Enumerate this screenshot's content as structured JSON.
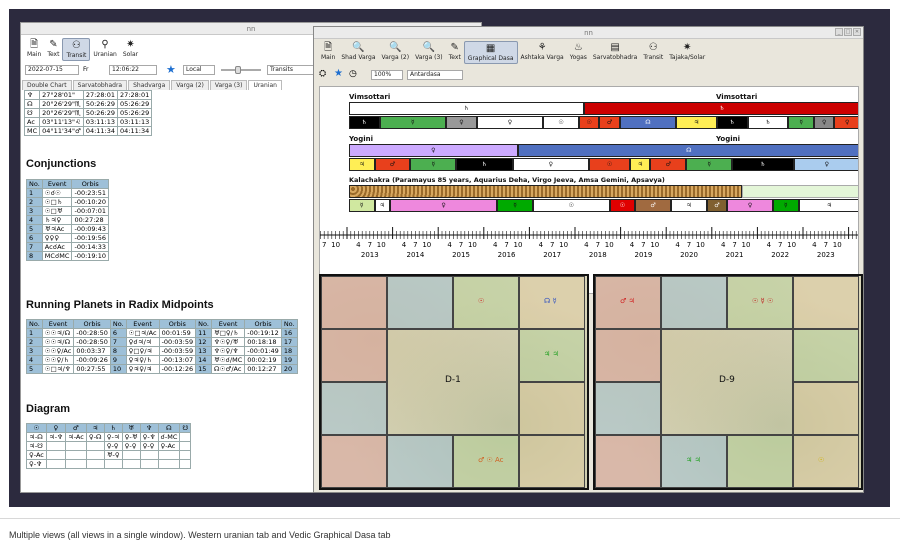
{
  "caption": "Multiple views (all views in a single window). Western uranian tab and Vedic Graphical Dasa tab",
  "left": {
    "title": "nn",
    "toolbar": [
      {
        "label": "Main",
        "icon": "doc-icon",
        "glyph": "🗎"
      },
      {
        "label": "Text",
        "icon": "edit-icon",
        "glyph": "✎"
      },
      {
        "label": "Transit",
        "icon": "transit-icon",
        "glyph": "⚇"
      },
      {
        "label": "Uranian",
        "icon": "uranian-icon",
        "glyph": "⚲"
      },
      {
        "label": "Solar",
        "icon": "solar-icon",
        "glyph": "✷"
      }
    ],
    "date": "2022-07-15",
    "day": "Fr",
    "time": "12:06:22",
    "tz": "Local",
    "mode": "Transits",
    "tabs": [
      "Double Chart",
      "Sarvatobhadra",
      "Shadvarga",
      "Varga (2)",
      "Varga (3)",
      "Uranian"
    ],
    "top_rows": [
      [
        "♆",
        "27°28'01\"",
        "27:28:01",
        "27:28:01"
      ],
      [
        "☊",
        "20°26'29\"♏",
        "50:26:29",
        "05:26:29"
      ],
      [
        "☋",
        "20°26'29\"♏",
        "50:26:29",
        "05:26:29"
      ],
      [
        "Ac",
        "03°11'13\"♌",
        "03:11:13",
        "03:11:13"
      ],
      [
        "MC",
        "04°11'34\"♂",
        "04:11:34",
        "04:11:34"
      ]
    ],
    "conj_title": "Conjunctions",
    "conj_headers": [
      "No.",
      "Event",
      "Orbis"
    ],
    "conj_rows": [
      [
        "1",
        "☉☌☉",
        "-00:23:51"
      ],
      [
        "2",
        "☉□♄",
        "-00:10:20"
      ],
      [
        "3",
        "☉□♅",
        "-00:07:01"
      ],
      [
        "4",
        "♄♃♀",
        "00:27:28"
      ],
      [
        "5",
        "♅♃Ac",
        "-00:09:43"
      ],
      [
        "6",
        "♀♀♀",
        "-00:19:56"
      ],
      [
        "7",
        "Ac☌Ac",
        "-00:14:33"
      ],
      [
        "8",
        "MC☌MC",
        "-00:19:10"
      ]
    ],
    "mid_title": "Running Planets in Radix Midpoints",
    "mid_headers": [
      "No.",
      "Event",
      "Orbis",
      "No.",
      "Event",
      "Orbis",
      "No.",
      "Event",
      "Orbis",
      "No."
    ],
    "mid_rows": [
      [
        "1",
        "☉☉♃/☊",
        "-00:28:50",
        "6",
        "☉□♃/Ac",
        "00:01:59",
        "11",
        "♅□♀/♄",
        "-00:19:12",
        "16"
      ],
      [
        "2",
        "☉☉♃/☊",
        "-00:28:50",
        "7",
        "♀☌♃/♃",
        "-00:03:59",
        "12",
        "♆☉♀/♅",
        "00:18:18",
        "17"
      ],
      [
        "3",
        "☉☉♀/Ac",
        "00:03:37",
        "8",
        "♀□♀/♃",
        "-00:03:59",
        "13",
        "♆☉♀/♆",
        "-00:01:49",
        "18"
      ],
      [
        "4",
        "☉☉♀/♄",
        "-00:09:26",
        "9",
        "♀♃♀/♄",
        "-00:13:07",
        "14",
        "♅☉☌/MC",
        "00:02:19",
        "19"
      ],
      [
        "5",
        "☉□♃/♆",
        "00:27:55",
        "10",
        "♀♃♀/♃",
        "-00:12:26",
        "15",
        "☊☉♂/Ac",
        "00:12:27",
        "20"
      ]
    ],
    "diag_title": "Diagram",
    "diag_headers": [
      "☉",
      "♀",
      "♂",
      "♃",
      "♄",
      "♅",
      "♆",
      "☊",
      "☋"
    ],
    "diag_rows": [
      [
        "♃-☊",
        "♃-♆",
        "♃-Ac",
        "♀-☊",
        "♀-♃",
        "♀-♅",
        "♀-♆",
        "☌-MC",
        ""
      ],
      [
        "♃-☋",
        "",
        "",
        "",
        "♀-♀",
        "♀-♀",
        "♀-♀",
        "♀-Ac",
        ""
      ],
      [
        "♀-Ac",
        "",
        "",
        "",
        "♅-♀",
        "",
        "",
        "",
        ""
      ],
      [
        "♀-♆",
        "",
        "",
        "",
        "",
        "",
        "",
        "",
        ""
      ]
    ]
  },
  "right": {
    "title": "nn",
    "toolbar": [
      {
        "label": "Main",
        "icon": "doc-icon",
        "glyph": "🗎"
      },
      {
        "label": "Shad Varga",
        "icon": "search-icon",
        "glyph": "🔍"
      },
      {
        "label": "Varga (2)",
        "icon": "search-icon",
        "glyph": "🔍"
      },
      {
        "label": "Varga (3)",
        "icon": "search-icon",
        "glyph": "🔍"
      },
      {
        "label": "Text",
        "icon": "edit-icon",
        "glyph": "✎"
      },
      {
        "label": "Graphical Dasa",
        "icon": "dasa-icon",
        "glyph": "▦"
      },
      {
        "label": "Ashtaka Varga",
        "icon": "ashtaka-icon",
        "glyph": "⚘"
      },
      {
        "label": "Yogas",
        "icon": "yogas-icon",
        "glyph": "♨"
      },
      {
        "label": "Sarvatobhadra",
        "icon": "grid-icon",
        "glyph": "▤"
      },
      {
        "label": "Transit",
        "icon": "transit-icon",
        "glyph": "⚇"
      },
      {
        "label": "Tajaka/Solar",
        "icon": "solar-icon",
        "glyph": "✷"
      }
    ],
    "zoom": "100%",
    "dasa_level": "Antardasa",
    "vims_label": "Vimsottari",
    "vims_label2": "Vimsottari",
    "yogini_label": "Yogini",
    "yogini_label2": "Yogini",
    "kala_label": "Kalachakra (Paramayus 85 years, Aquarius Deha, Virgo Jeeva, Amsa Gemini, Apsavya)",
    "vims_main": [
      {
        "label": "♄",
        "from": 0,
        "to": 0.46,
        "color": "#ffffff"
      },
      {
        "label": "♄",
        "from": 0.46,
        "to": 1.0,
        "color": "#cc0000"
      }
    ],
    "vims_sub": [
      {
        "label": "♄",
        "from": 0,
        "to": 0.06,
        "color": "#000000"
      },
      {
        "label": "☿",
        "from": 0.06,
        "to": 0.19,
        "color": "#4caf50"
      },
      {
        "label": "♀",
        "from": 0.19,
        "to": 0.25,
        "color": "#999999"
      },
      {
        "label": "♀",
        "from": 0.25,
        "to": 0.38,
        "color": "#ffffff"
      },
      {
        "label": "☉",
        "from": 0.38,
        "to": 0.45,
        "color": "#ffffff"
      },
      {
        "label": "☉",
        "from": 0.45,
        "to": 0.49,
        "color": "#e8401c"
      },
      {
        "label": "♂",
        "from": 0.49,
        "to": 0.53,
        "color": "#e8401c"
      },
      {
        "label": "☊",
        "from": 0.53,
        "to": 0.64,
        "color": "#5070c0"
      },
      {
        "label": "♃",
        "from": 0.64,
        "to": 0.72,
        "color": "#ffee55"
      },
      {
        "label": "♄",
        "from": 0.72,
        "to": 0.78,
        "color": "#000000"
      },
      {
        "label": "♄",
        "from": 0.78,
        "to": 0.86,
        "color": "#ffffff"
      },
      {
        "label": "☿",
        "from": 0.86,
        "to": 0.91,
        "color": "#4caf50"
      },
      {
        "label": "♀",
        "from": 0.91,
        "to": 0.95,
        "color": "#888888"
      },
      {
        "label": "♀",
        "from": 0.95,
        "to": 1.0,
        "color": "#e8401c"
      }
    ],
    "yog_main": [
      {
        "label": "♀",
        "from": 0,
        "to": 0.33,
        "color": "#ccaaff"
      },
      {
        "label": "☊",
        "from": 0.33,
        "to": 1.0,
        "color": "#5070c0"
      }
    ],
    "yog_sub": [
      {
        "label": "♃",
        "from": 0,
        "to": 0.05,
        "color": "#ffee55"
      },
      {
        "label": "♂",
        "from": 0.05,
        "to": 0.12,
        "color": "#e8401c"
      },
      {
        "label": "☿",
        "from": 0.12,
        "to": 0.21,
        "color": "#4caf50"
      },
      {
        "label": "♄",
        "from": 0.21,
        "to": 0.32,
        "color": "#000000"
      },
      {
        "label": "♀",
        "from": 0.32,
        "to": 0.47,
        "color": "#ffffff"
      },
      {
        "label": "☉",
        "from": 0.47,
        "to": 0.55,
        "color": "#e8401c"
      },
      {
        "label": "♃",
        "from": 0.55,
        "to": 0.59,
        "color": "#ffee55"
      },
      {
        "label": "♂",
        "from": 0.59,
        "to": 0.66,
        "color": "#e8401c"
      },
      {
        "label": "☿",
        "from": 0.66,
        "to": 0.75,
        "color": "#4caf50"
      },
      {
        "label": "♄",
        "from": 0.75,
        "to": 0.87,
        "color": "#000000"
      },
      {
        "label": "♀",
        "from": 0.87,
        "to": 1.0,
        "color": "#aaccee"
      }
    ],
    "kala_sub": [
      {
        "label": "☿",
        "from": 0,
        "to": 0.05,
        "color": "#d0e8a0"
      },
      {
        "label": "♃",
        "from": 0.05,
        "to": 0.08,
        "color": "#ffffff"
      },
      {
        "label": "♀",
        "from": 0.08,
        "to": 0.29,
        "color": "#ee88dd"
      },
      {
        "label": "☿",
        "from": 0.29,
        "to": 0.36,
        "color": "#00aa00"
      },
      {
        "label": "☉",
        "from": 0.36,
        "to": 0.51,
        "color": "#ffffff"
      },
      {
        "label": "☉",
        "from": 0.51,
        "to": 0.56,
        "color": "#e00000"
      },
      {
        "label": "♂",
        "from": 0.56,
        "to": 0.63,
        "color": "#a06a40"
      },
      {
        "label": "♃",
        "from": 0.63,
        "to": 0.7,
        "color": "#ffffff"
      },
      {
        "label": "♂",
        "from": 0.7,
        "to": 0.74,
        "color": "#806030"
      },
      {
        "label": "♀",
        "from": 0.74,
        "to": 0.83,
        "color": "#ee88dd"
      },
      {
        "label": "☿",
        "from": 0.83,
        "to": 0.88,
        "color": "#00aa00"
      },
      {
        "label": "♃",
        "from": 0.88,
        "to": 1.0,
        "color": "#ffffff"
      }
    ],
    "tick_labels": [
      "4",
      "7",
      "10"
    ],
    "years": [
      "2013",
      "2014",
      "2015",
      "2016",
      "2017",
      "2018",
      "2019",
      "2020",
      "2021",
      "2022",
      "2023"
    ],
    "chart1_title": "D-1",
    "chart2_title": "D-9",
    "chart1_planets": [
      {
        "text": "☊ ☿",
        "color": "#3050c0",
        "cell": "tr1"
      },
      {
        "text": "☉",
        "color": "#d02020",
        "cell": "tr2"
      },
      {
        "text": "♃ ♃",
        "color": "#20a020",
        "cell": "r2"
      },
      {
        "text": "♂ ☉ Ac",
        "color": "#d06020",
        "cell": "br2"
      }
    ],
    "chart2_planets": [
      {
        "text": "♂ ♃",
        "color": "#d02020",
        "cell": "tl1"
      },
      {
        "text": "☉ ☿ ☉",
        "color": "#c02020",
        "cell": "tr2"
      },
      {
        "text": "♃ ♃",
        "color": "#20a020",
        "cell": "bl2"
      },
      {
        "text": "☉",
        "color": "#d0b000",
        "cell": "br1"
      }
    ]
  }
}
